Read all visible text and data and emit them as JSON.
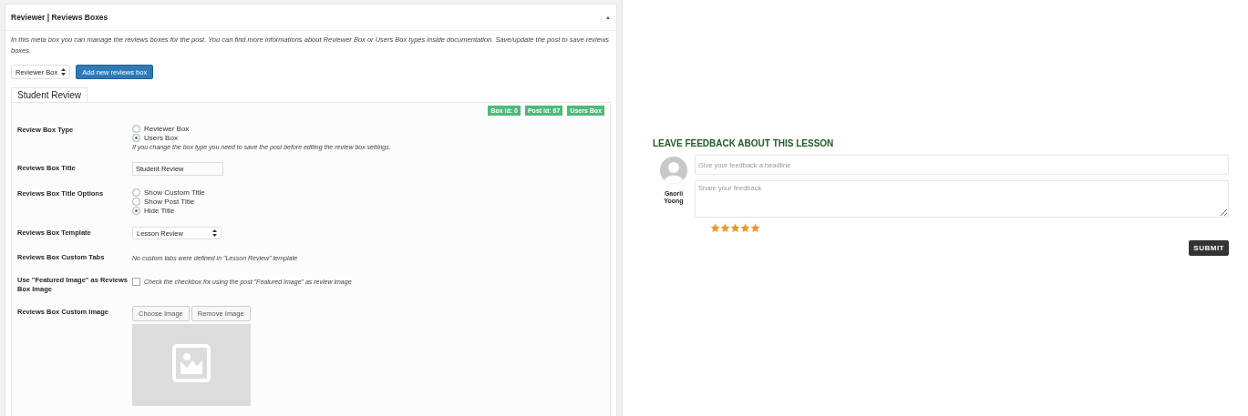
{
  "metabox": {
    "title": "Reviewer | Reviews Boxes",
    "toggle": "▲",
    "description": "In this meta box you can manage the reviews boxes for the post. You can find more informations about Reviewer Box or Users Box types inside documentation. Save/update the post to save reviews boxes.",
    "box_select": "Reviewer Box",
    "add_button": "Add new reviews box",
    "tabs": [
      {
        "label": "Student Review",
        "selected": true
      }
    ],
    "badges": [
      "Box id: 0",
      "Post id: 67",
      "Users Box"
    ],
    "fields": [
      {
        "kind": "radio",
        "label": "Review Box Type",
        "options": [
          {
            "label": "Reviewer Box",
            "selected": false
          },
          {
            "label": "Users Box",
            "selected": true
          }
        ],
        "note": "If you change the box type you need to save the post before editing the review box settings."
      },
      {
        "kind": "text",
        "label": "Reviews Box Title",
        "value": "Student Review"
      },
      {
        "kind": "radio",
        "label": "Reviews Box Title Options",
        "options": [
          {
            "label": "Show Custom Title",
            "selected": false
          },
          {
            "label": "Show Post Title",
            "selected": false
          },
          {
            "label": "Hide Title",
            "selected": true
          }
        ]
      },
      {
        "kind": "select",
        "label": "Reviews Box Template",
        "value": "Lesson Review"
      },
      {
        "kind": "note",
        "label": "Reviews Box Custom Tabs",
        "note": "No custom tabs were defined in \"Lesson Review\" template"
      },
      {
        "kind": "checkbox",
        "label": "Use \"Featured Image\" as Reviews Box Image",
        "checked": false,
        "note": "Check the checkbox for using the post \"Featured Image\" as review image"
      },
      {
        "kind": "image",
        "label": "Reviews Box Custom Image",
        "buttons": [
          "Choose Image",
          "Remove Image"
        ]
      }
    ]
  },
  "feedback": {
    "heading": "LEAVE FEEDBACK ABOUT THIS LESSON",
    "user_name": "Gaorii Yoong",
    "headline_placeholder": "Give your feedback a headline",
    "body_placeholder": "Share your feedback",
    "stars": 5,
    "submit": "SUBMIT"
  }
}
